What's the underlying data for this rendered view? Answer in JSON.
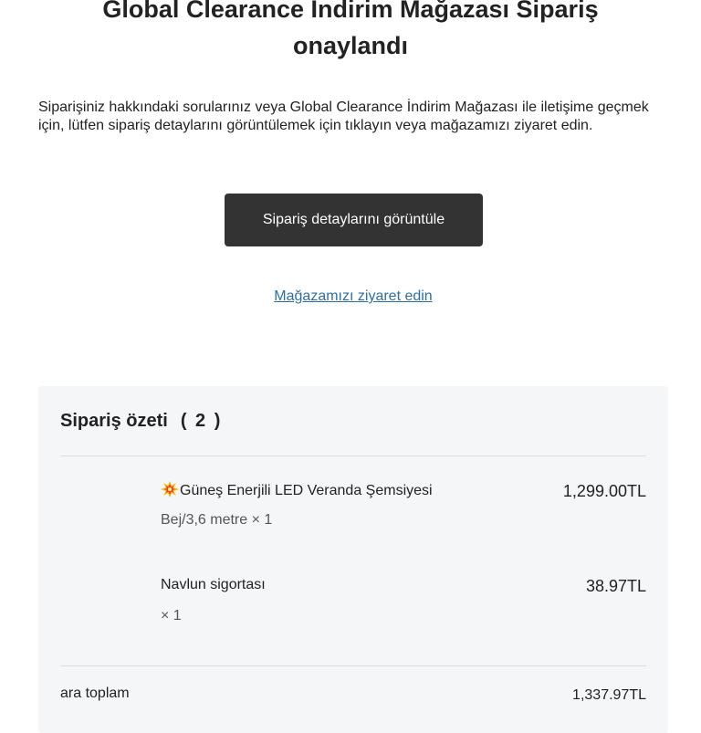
{
  "header": {
    "title_line1": "Global Clearance İndirim Mağazası Sipariş",
    "title_line2": "onaylandı"
  },
  "intro": {
    "text": "Siparişiniz hakkındaki sorularınız veya Global Clearance İndirim Mağazası ile iletişime geçmek için, lütfen sipariş detaylarını görüntülemek için tıklayın veya mağazamızı ziyaret edin."
  },
  "actions": {
    "view_details_label": "Sipariş detaylarını görüntüle",
    "visit_store_label": "Mağazamızı ziyaret edin"
  },
  "summary": {
    "title": "Sipariş özeti",
    "count": "( 2 )",
    "items": [
      {
        "icon": "collision-emoji-icon",
        "name": "Güneş Enerjili LED Veranda Şemsiyesi",
        "variant": "Bej/3,6 metre × 1",
        "price": "1,299.00TL"
      },
      {
        "name": "Navlun sigortası",
        "variant": "× 1",
        "price": "38.97TL"
      }
    ],
    "subtotal_label": "ara toplam",
    "subtotal_value": "1,337.97TL"
  },
  "colors": {
    "button_bg": "#333333",
    "link": "#2c6fa8",
    "summary_bg": "#f5f6f7"
  }
}
